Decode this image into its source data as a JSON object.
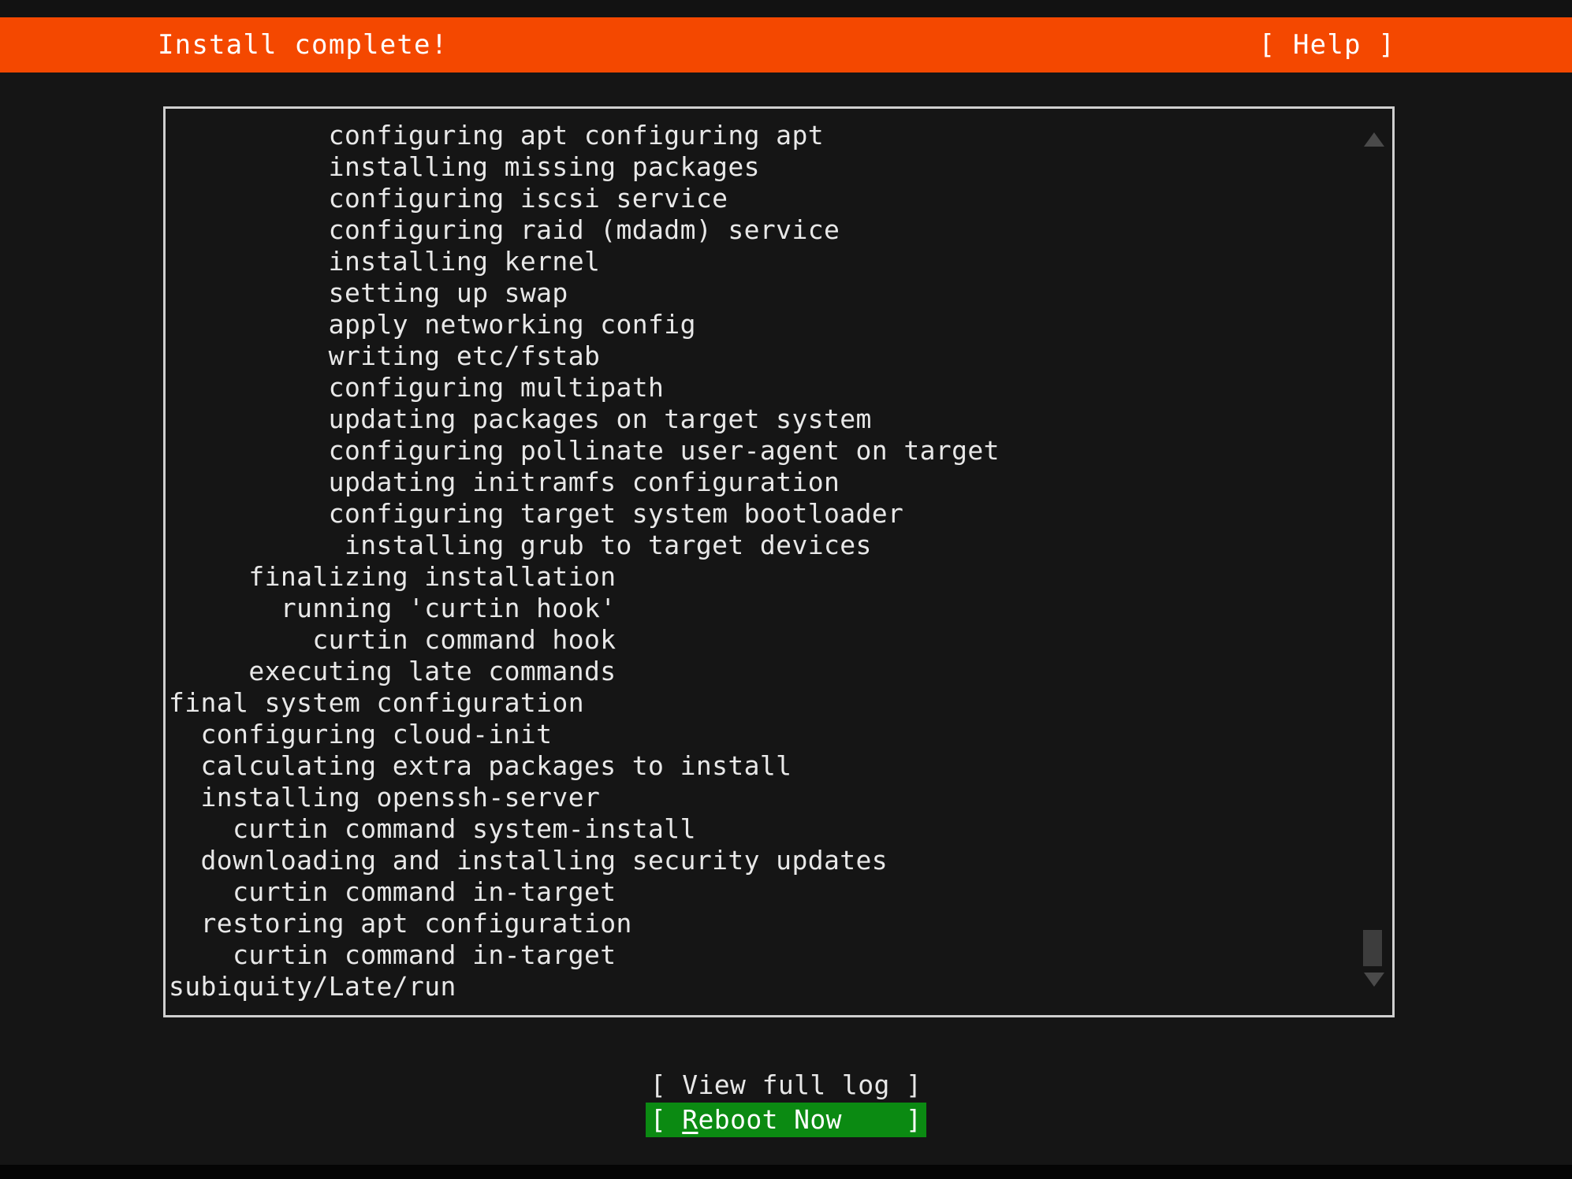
{
  "header": {
    "title": "Install complete!",
    "help_label": "[ Help ]",
    "background_color": "#F44800",
    "text_color": "#FFFFFF"
  },
  "log": {
    "border_color": "#CFCFCF",
    "text_color": "#E8E8E8",
    "background_color": "#151515",
    "lines": [
      "          configuring apt configuring apt",
      "          installing missing packages",
      "          configuring iscsi service",
      "          configuring raid (mdadm) service",
      "          installing kernel",
      "          setting up swap",
      "          apply networking config",
      "          writing etc/fstab",
      "          configuring multipath",
      "          updating packages on target system",
      "          configuring pollinate user-agent on target",
      "          updating initramfs configuration",
      "          configuring target system bootloader",
      "           installing grub to target devices",
      "     finalizing installation",
      "       running 'curtin hook'",
      "         curtin command hook",
      "     executing late commands",
      "final system configuration",
      "  configuring cloud-init",
      "  calculating extra packages to install",
      "  installing openssh-server",
      "    curtin command system-install",
      "  downloading and installing security updates",
      "    curtin command in-target",
      "  restoring apt configuration",
      "    curtin command in-target",
      "subiquity/Late/run"
    ]
  },
  "scrollbar": {
    "up_arrow_icon": "triangle-up-icon",
    "down_arrow_icon": "triangle-down-icon",
    "thumb_color": "#3D3D3D",
    "arrow_color": "#4A4A4A"
  },
  "buttons": {
    "view_full_log": "[ View full log ]",
    "reboot_now_prefix": "[ ",
    "reboot_now_accel": "R",
    "reboot_now_rest": "eboot Now",
    "reboot_now_suffix": "    ]",
    "reboot_selected_bg": "#0B8A12",
    "reboot_selected_fg": "#FFFFFF"
  }
}
